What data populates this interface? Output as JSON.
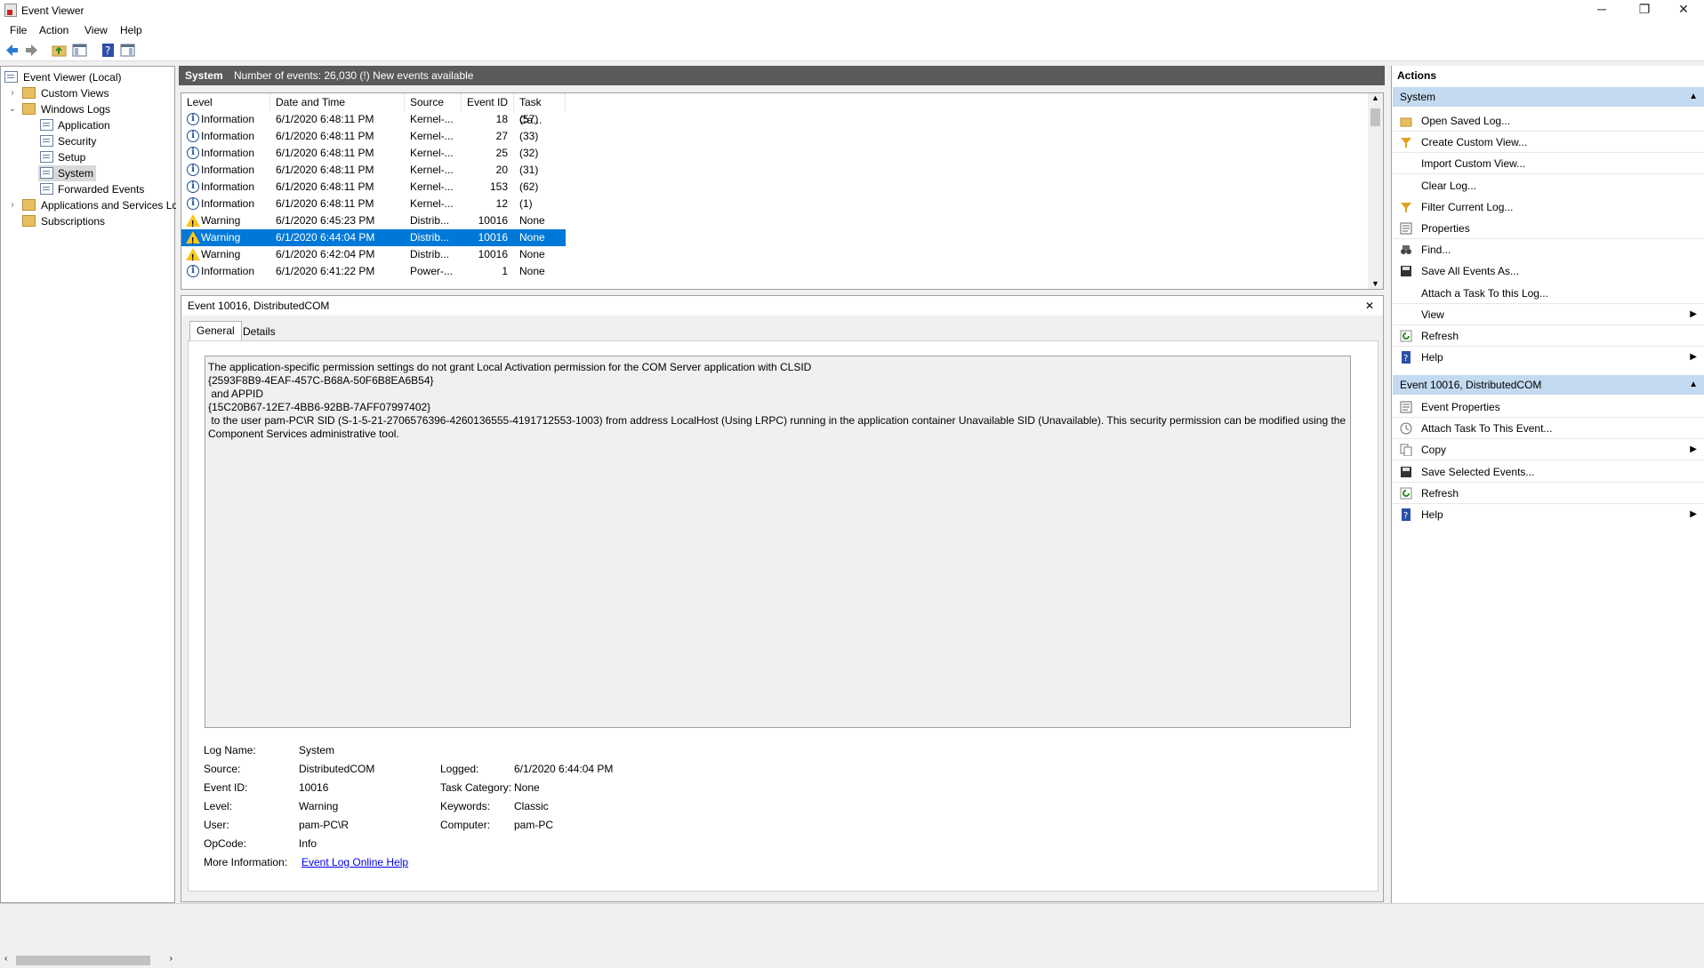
{
  "window": {
    "title": "Event Viewer",
    "minimize": "─",
    "restore": "❐",
    "close": "✕"
  },
  "menu": [
    "File",
    "Action",
    "View",
    "Help"
  ],
  "toolbar": [
    "back-icon",
    "forward-icon",
    "folder-up-icon",
    "show-hide-tree-icon",
    "help-icon",
    "show-hide-action-pane-icon"
  ],
  "tree": {
    "root": "Event Viewer (Local)",
    "custom_views": "Custom Views",
    "windows_logs": "Windows Logs",
    "application": "Application",
    "security": "Security",
    "setup": "Setup",
    "system": "System",
    "forwarded": "Forwarded Events",
    "apps_services": "Applications and Services Lo",
    "subscriptions": "Subscriptions"
  },
  "center": {
    "log_name": "System",
    "summary": "Number of events: 26,030 (!) New events available"
  },
  "list": {
    "columns": [
      "Level",
      "Date and Time",
      "Source",
      "Event ID",
      "Task Ca..."
    ],
    "rows": [
      {
        "level": "Information",
        "date": "6/1/2020 6:48:11 PM",
        "source": "Kernel-...",
        "id": "18",
        "task": "(57)",
        "type": "info"
      },
      {
        "level": "Information",
        "date": "6/1/2020 6:48:11 PM",
        "source": "Kernel-...",
        "id": "27",
        "task": "(33)",
        "type": "info"
      },
      {
        "level": "Information",
        "date": "6/1/2020 6:48:11 PM",
        "source": "Kernel-...",
        "id": "25",
        "task": "(32)",
        "type": "info"
      },
      {
        "level": "Information",
        "date": "6/1/2020 6:48:11 PM",
        "source": "Kernel-...",
        "id": "20",
        "task": "(31)",
        "type": "info"
      },
      {
        "level": "Information",
        "date": "6/1/2020 6:48:11 PM",
        "source": "Kernel-...",
        "id": "153",
        "task": "(62)",
        "type": "info"
      },
      {
        "level": "Information",
        "date": "6/1/2020 6:48:11 PM",
        "source": "Kernel-...",
        "id": "12",
        "task": "(1)",
        "type": "info"
      },
      {
        "level": "Warning",
        "date": "6/1/2020 6:45:23 PM",
        "source": "Distrib...",
        "id": "10016",
        "task": "None",
        "type": "warn"
      },
      {
        "level": "Warning",
        "date": "6/1/2020 6:44:04 PM",
        "source": "Distrib...",
        "id": "10016",
        "task": "None",
        "type": "warn",
        "selected": true
      },
      {
        "level": "Warning",
        "date": "6/1/2020 6:42:04 PM",
        "source": "Distrib...",
        "id": "10016",
        "task": "None",
        "type": "warn"
      },
      {
        "level": "Information",
        "date": "6/1/2020 6:41:22 PM",
        "source": "Power-...",
        "id": "1",
        "task": "None",
        "type": "info"
      }
    ]
  },
  "detail": {
    "header": "Event 10016, DistributedCOM",
    "close": "✕",
    "tabs": [
      "General",
      "Details"
    ],
    "message": "The application-specific permission settings do not grant Local Activation permission for the COM Server application with CLSID \n{2593F8B9-4EAF-457C-B68A-50F6B8EA6B54}\n and APPID \n{15C20B67-12E7-4BB6-92BB-7AFF07997402}\n to the user pam-PC\\R SID (S-1-5-21-2706576396-4260136555-4191712553-1003) from address LocalHost (Using LRPC) running in the application container Unavailable SID (Unavailable). This security permission can be modified using the Component Services administrative tool.",
    "fields": {
      "log_name_label": "Log Name:",
      "log_name": "System",
      "source_label": "Source:",
      "source": "DistributedCOM",
      "logged_label": "Logged:",
      "logged": "6/1/2020 6:44:04 PM",
      "event_id_label": "Event ID:",
      "event_id": "10016",
      "task_label": "Task Category:",
      "task": "None",
      "level_label": "Level:",
      "level": "Warning",
      "keywords_label": "Keywords:",
      "keywords": "Classic",
      "user_label": "User:",
      "user": "pam-PC\\R",
      "computer_label": "Computer:",
      "computer": "pam-PC",
      "opcode_label": "OpCode:",
      "opcode": "Info",
      "more_info_label": "More Information:",
      "more_info_link": "Event Log Online Help"
    }
  },
  "actions": {
    "title": "Actions",
    "system_header": "System",
    "system_items": [
      {
        "label": "Open Saved Log...",
        "icon": "open-folder-icon"
      },
      {
        "label": "Create Custom View...",
        "icon": "filter-icon"
      },
      {
        "label": "Import Custom View...",
        "icon": ""
      },
      {
        "label": "Clear Log...",
        "icon": ""
      },
      {
        "label": "Filter Current Log...",
        "icon": "filter-icon"
      },
      {
        "label": "Properties",
        "icon": "properties-icon"
      },
      {
        "label": "Find...",
        "icon": "binoculars-icon"
      },
      {
        "label": "Save All Events As...",
        "icon": "save-icon"
      },
      {
        "label": "Attach a Task To this Log...",
        "icon": ""
      },
      {
        "label": "View",
        "icon": "",
        "submenu": true
      },
      {
        "label": "Refresh",
        "icon": "refresh-icon"
      },
      {
        "label": "Help",
        "icon": "help-icon",
        "submenu": true
      }
    ],
    "event_header": "Event 10016, DistributedCOM",
    "event_items": [
      {
        "label": "Event Properties",
        "icon": "properties-icon"
      },
      {
        "label": "Attach Task To This Event...",
        "icon": "task-icon"
      },
      {
        "label": "Copy",
        "icon": "copy-icon",
        "submenu": true
      },
      {
        "label": "Save Selected Events...",
        "icon": "save-icon"
      },
      {
        "label": "Refresh",
        "icon": "refresh-icon"
      },
      {
        "label": "Help",
        "icon": "help-icon",
        "submenu": true
      }
    ]
  },
  "colors": {
    "selection": "#0078d7",
    "header_dark": "#5a5a5a",
    "action_header": "#c3daf0"
  }
}
